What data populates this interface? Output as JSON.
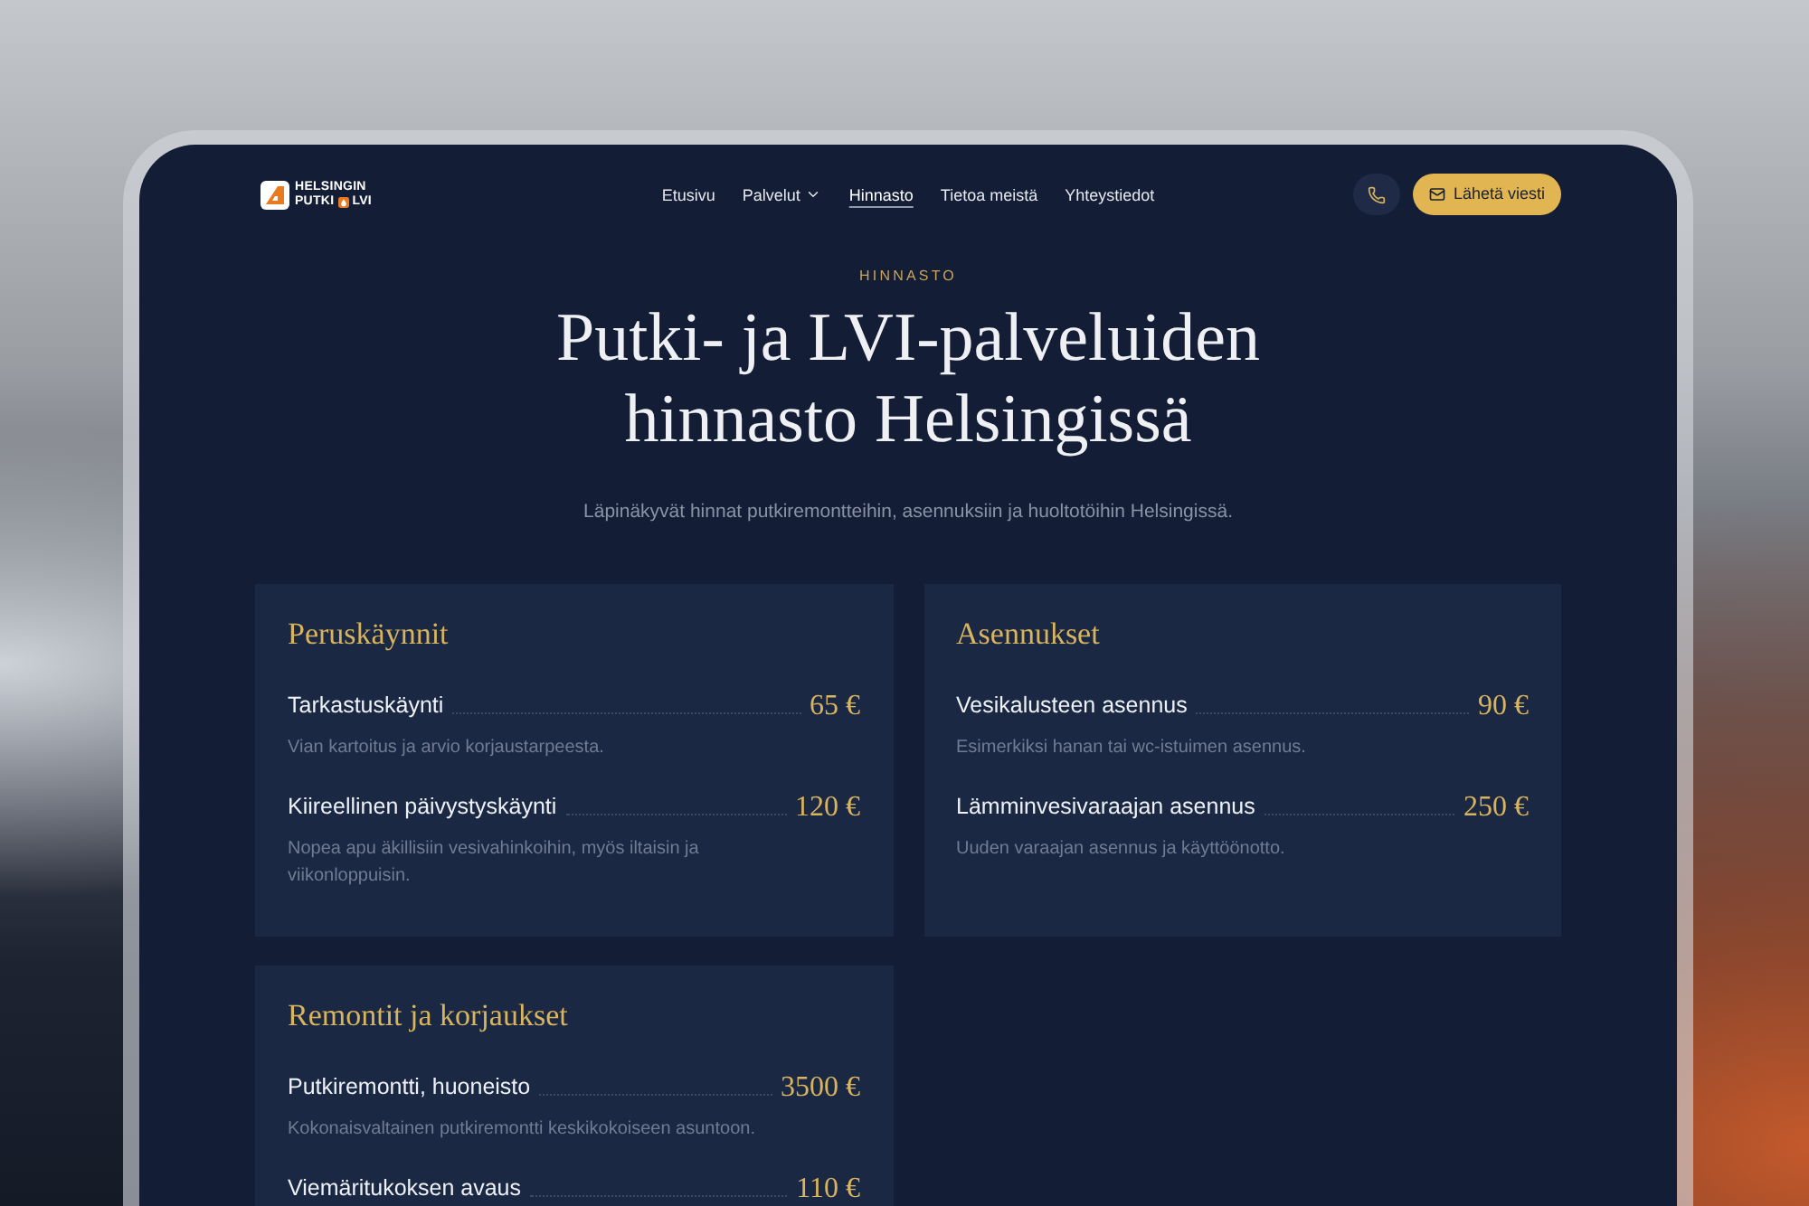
{
  "header": {
    "logo": {
      "line_1": "HELSINGIN",
      "line_2_left": "PUTKI",
      "line_2_right": "LVI"
    },
    "nav": [
      {
        "label": "Etusivu",
        "selected": false,
        "has_menu": false
      },
      {
        "label": "Palvelut",
        "selected": false,
        "has_menu": true
      },
      {
        "label": "Hinnasto",
        "selected": true,
        "has_menu": false
      },
      {
        "label": "Tietoa meistä",
        "selected": false,
        "has_menu": false
      },
      {
        "label": "Yhteystiedot",
        "selected": false,
        "has_menu": false
      }
    ],
    "cta_button": {
      "label": "Lähetä viesti"
    }
  },
  "hero": {
    "eyebrow": "HINNASTO",
    "title": "Putki- ja LVI-palveluiden hinnasto Helsingissä",
    "subtitle": "Läpinäkyvät hinnat putkiremontteihin, asennuksiin ja huoltotöihin Helsingissä."
  },
  "price_groups": [
    {
      "title": "Peruskäynnit",
      "items": [
        {
          "name": "Tarkastuskäynti",
          "price": "65 €",
          "description": "Vian kartoitus ja arvio korjaustarpeesta."
        },
        {
          "name": "Kiireellinen päivystyskäynti",
          "price": "120 €",
          "description": "Nopea apu äkillisiin vesivahinkoihin, myös iltaisin ja viikonloppuisin."
        }
      ]
    },
    {
      "title": "Asennukset",
      "items": [
        {
          "name": "Vesikalusteen asennus",
          "price": "90 €",
          "description": "Esimerkiksi hanan tai wc-istuimen asennus."
        },
        {
          "name": "Lämminvesivaraajan asennus",
          "price": "250 €",
          "description": "Uuden varaajan asennus ja käyttöönotto."
        }
      ]
    },
    {
      "title": "Remontit ja korjaukset",
      "items": [
        {
          "name": "Putkiremontti, huoneisto",
          "price": "3500 €",
          "description": "Kokonaisvaltainen putkiremontti keskikokoiseen asuntoon."
        },
        {
          "name": "Viemäritukoksen avaus",
          "price": "110 €"
        }
      ]
    }
  ]
}
